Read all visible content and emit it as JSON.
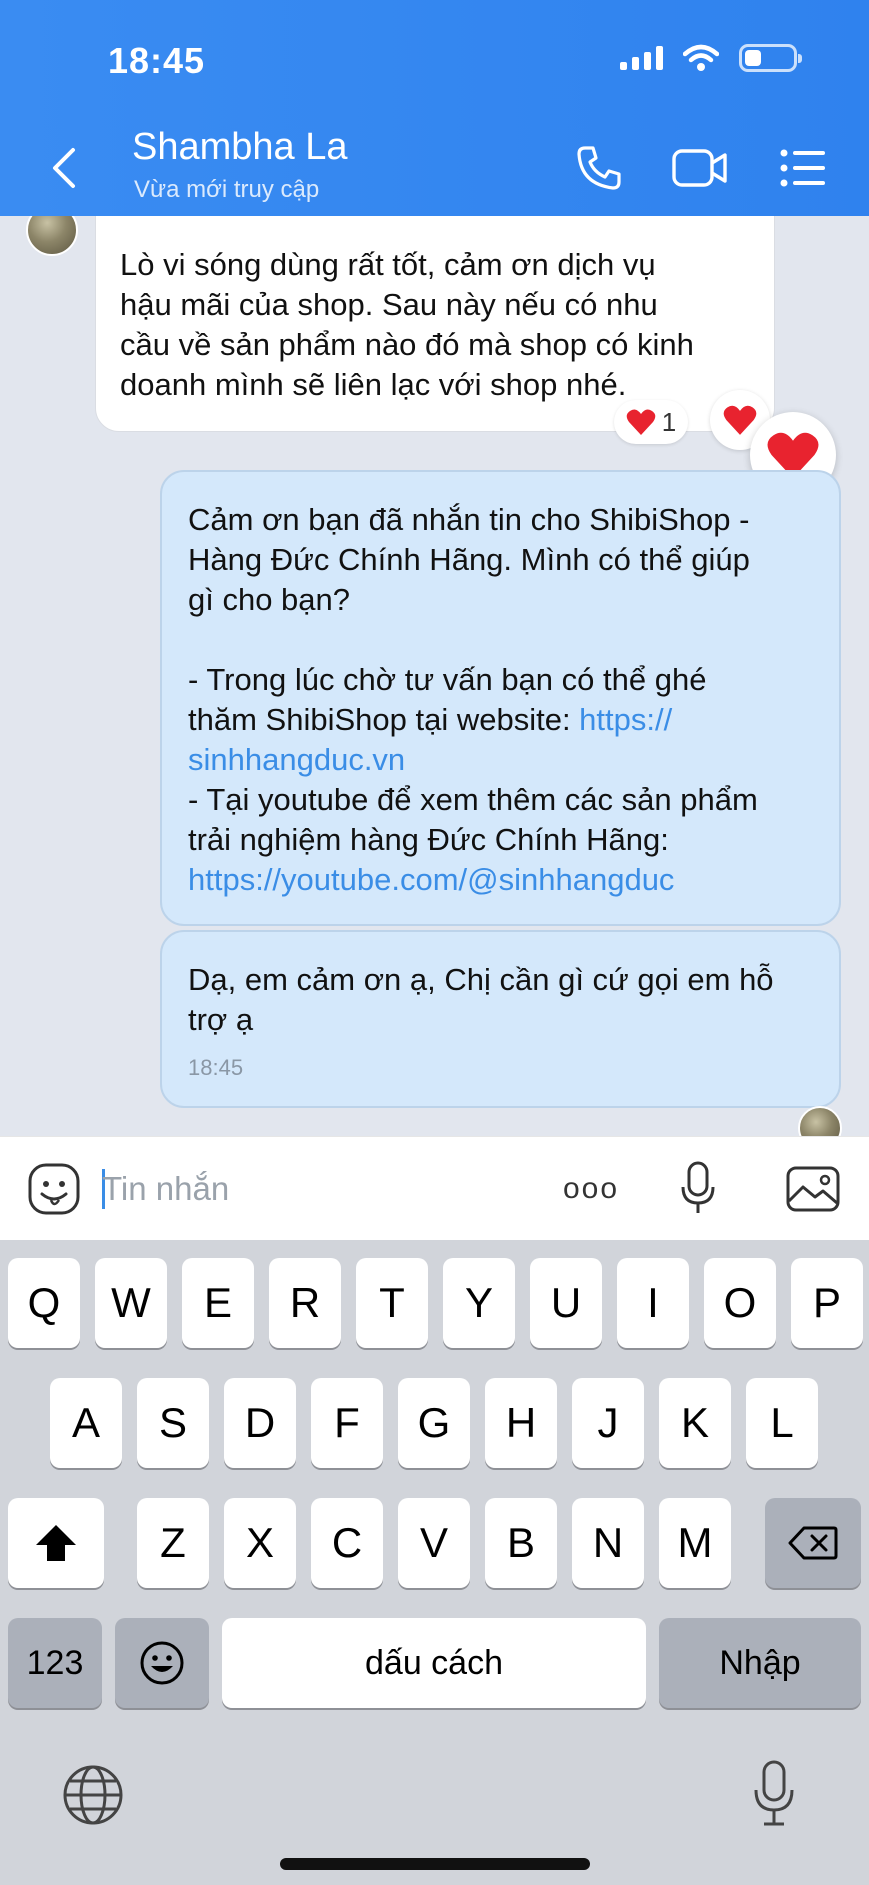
{
  "status_bar": {
    "time": "18:45"
  },
  "header": {
    "contact_name": "Shambha La",
    "contact_status": "Vừa mới truy cập",
    "accent_color": "#3489f0"
  },
  "messages": [
    {
      "direction": "incoming",
      "text": "Lò vi sóng dùng rất tốt, cảm ơn dịch vụ\nhậu mãi của shop. Sau này nếu có nhu\ncầu về sản phẩm nào đó mà shop có kinh\ndoanh mình sẽ liên lạc với shop nhé.",
      "reaction_icon": "heart",
      "reaction_count": "1"
    },
    {
      "direction": "outgoing",
      "text_1": "Cảm ơn bạn đã nhắn tin cho ShibiShop -\nHàng Đức Chính Hãng. Mình có thể giúp\ngì cho bạn?\n\n- Trong lúc chờ tư vấn bạn có thể ghé\nthăm ShibiShop tại website: ",
      "link_1": "https://\nsinhhangduc.vn",
      "text_2": "\n- Tại youtube để xem thêm các sản phẩm\ntrải nghiệm hàng Đức Chính Hãng:\n",
      "link_2": "https://youtube.com/@sinhhangduc"
    },
    {
      "direction": "outgoing",
      "text": "Dạ, em cảm ơn ạ, Chị cần gì cứ gọi em hỗ\ntrợ ạ",
      "time": "18:45"
    }
  ],
  "input": {
    "placeholder": "Tin nhắn",
    "more_label": "ooo"
  },
  "keyboard": {
    "row1": [
      "Q",
      "W",
      "E",
      "R",
      "T",
      "Y",
      "U",
      "I",
      "O",
      "P"
    ],
    "row2": [
      "A",
      "S",
      "D",
      "F",
      "G",
      "H",
      "J",
      "K",
      "L"
    ],
    "row3": [
      "Z",
      "X",
      "C",
      "V",
      "B",
      "N",
      "M"
    ],
    "numbers_label": "123",
    "space_label": "dấu cách",
    "return_label": "Nhập"
  }
}
